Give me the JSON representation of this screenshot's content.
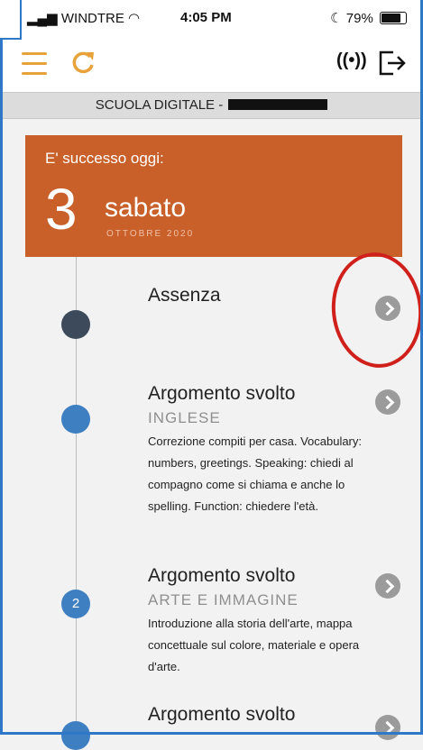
{
  "status": {
    "carrier": "WINDTRE",
    "time": "4:05 PM",
    "battery": "79%"
  },
  "header": {
    "school_title": "SCUOLA DIGITALE -"
  },
  "date_card": {
    "caption": "E' successo oggi:",
    "day": "3",
    "weekday": "sabato",
    "month_year": "OTTOBRE 2020"
  },
  "events": [
    {
      "title": "Assenza",
      "badge": ""
    },
    {
      "title": "Argomento svolto",
      "subject": "INGLESE",
      "description": "Correzione compiti per casa. Vocabulary: numbers, greetings. Speaking: chiedi al compagno come si chiama e anche lo spelling. Function: chiedere l'età."
    },
    {
      "title": "Argomento svolto",
      "subject": "ARTE E IMMAGINE",
      "badge": "2",
      "description": "Introduzione alla storia dell'arte, mappa concettuale sul colore, materiale e opera d'arte."
    },
    {
      "title": "Argomento svolto"
    }
  ],
  "colors": {
    "accent": "#e8a23a",
    "date_card": "#c9602a",
    "dot_dark": "#3c4a5c",
    "dot_blue": "#3e7fc1",
    "annotation": "#d0201b"
  },
  "icons": [
    "menu-icon",
    "refresh-icon",
    "signal-icon",
    "logout-icon",
    "chevron-right-icon"
  ]
}
